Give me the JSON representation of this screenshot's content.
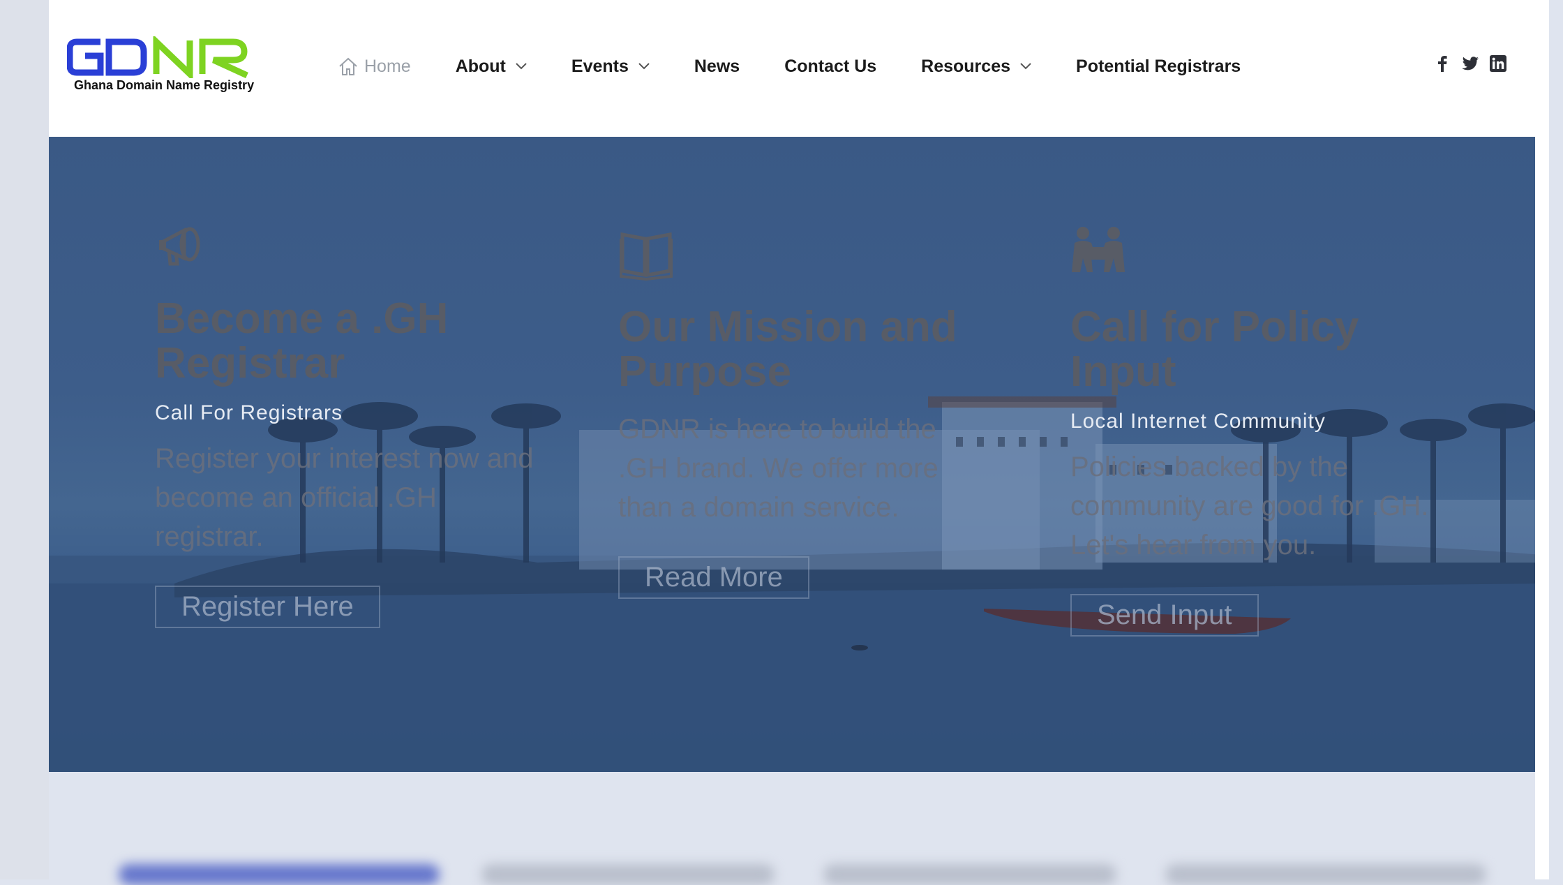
{
  "brand": {
    "logo_text": "GDNR",
    "tagline": "Ghana Domain Name Registry",
    "colors": {
      "blue": "#2a3fd6",
      "green": "#7ed321"
    }
  },
  "nav": {
    "items": [
      {
        "label": "Home",
        "icon": "home-icon",
        "active": true
      },
      {
        "label": "About",
        "dropdown": true
      },
      {
        "label": "Events",
        "dropdown": true
      },
      {
        "label": "News"
      },
      {
        "label": "Contact Us"
      },
      {
        "label": "Resources",
        "dropdown": true
      },
      {
        "label": "Potential Registrars"
      }
    ]
  },
  "socials": [
    "facebook-icon",
    "twitter-icon",
    "linkedin-icon"
  ],
  "hero": {
    "cards": [
      {
        "icon": "megaphone-icon",
        "title": "Become a .GH Registrar",
        "subtitle": "Call For Registrars",
        "text": "Register your interest now and become an official .GH registrar.",
        "button": "Register Here"
      },
      {
        "icon": "book-icon",
        "title": "Our Mission and Purpose",
        "subtitle": "",
        "text": "GDNR is here to build the .GH brand. We offer more than a domain service.",
        "button": "Read More"
      },
      {
        "icon": "community-icon",
        "title": "Call for Policy Input",
        "subtitle": "Local Internet Community",
        "text": "Policies backed by the community are good for .GH. Let's hear from you.",
        "button": "Send Input"
      }
    ]
  }
}
